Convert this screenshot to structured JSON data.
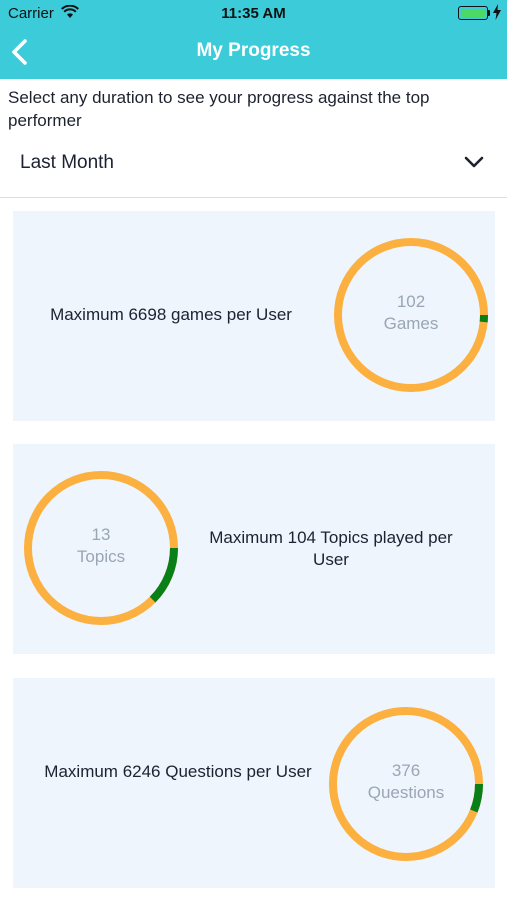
{
  "status_bar": {
    "carrier": "Carrier",
    "time": "11:35 AM"
  },
  "nav": {
    "title": "My Progress"
  },
  "prompt": "Select any duration to see your progress against the top performer",
  "duration": {
    "selected": "Last Month"
  },
  "colors": {
    "nav": "#3ccbd9",
    "ring_track": "#fbb040",
    "ring_progress": "#0b7f17",
    "card_bg": "#eef5fd"
  },
  "cards": [
    {
      "text": "Maximum 6698 games per User",
      "value": "102",
      "unit": "Games",
      "progress": 0.0152
    },
    {
      "text": "Maximum 104 Topics played per User",
      "value": "13",
      "unit": "Topics",
      "progress": 0.125
    },
    {
      "text": "Maximum 6246 Questions per User",
      "value": "376",
      "unit": "Questions",
      "progress": 0.0602
    }
  ]
}
